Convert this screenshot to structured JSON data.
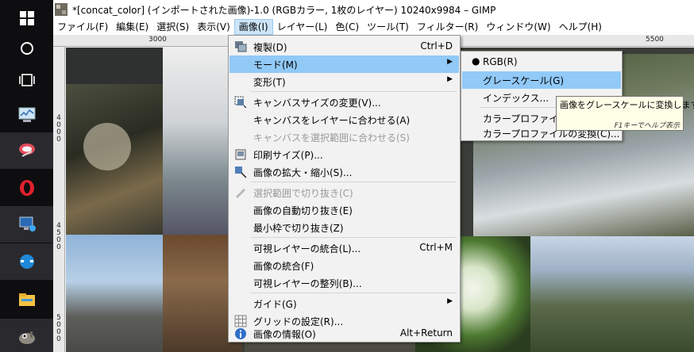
{
  "window": {
    "title": "*[concat_color] (インポートされた画像)-1.0 (RGBカラー, 1枚のレイヤー) 10240x9984 – GIMP"
  },
  "menubar": [
    {
      "label": "ファイル(F)"
    },
    {
      "label": "編集(E)"
    },
    {
      "label": "選択(S)"
    },
    {
      "label": "表示(V)"
    },
    {
      "label": "画像(I)"
    },
    {
      "label": "レイヤー(L)"
    },
    {
      "label": "色(C)"
    },
    {
      "label": "ツール(T)"
    },
    {
      "label": "フィルター(R)"
    },
    {
      "label": "ウィンドウ(W)"
    },
    {
      "label": "ヘルプ(H)"
    }
  ],
  "rulers": {
    "top": [
      "3000",
      "5500"
    ],
    "left": [
      "4000",
      "4500",
      "5000"
    ]
  },
  "image_menu": {
    "items": [
      {
        "label": "複製(D)",
        "shortcut": "Ctrl+D",
        "icon": "duplicate-icon"
      },
      {
        "label": "モード(M)",
        "submenu": true
      },
      {
        "label": "変形(T)",
        "submenu": true
      },
      {
        "label": "キャンバスサイズの変更(V)...",
        "icon": "canvas-size-icon"
      },
      {
        "label": "キャンバスをレイヤーに合わせる(A)"
      },
      {
        "label": "キャンバスを選択範囲に合わせる(S)",
        "disabled": true
      },
      {
        "label": "印刷サイズ(P)...",
        "icon": "print-size-icon"
      },
      {
        "label": "画像の拡大・縮小(S)...",
        "icon": "scale-icon"
      },
      {
        "label": "選択範囲で切り抜き(C)",
        "disabled": true,
        "icon": "crop-icon"
      },
      {
        "label": "画像の自動切り抜き(E)"
      },
      {
        "label": "最小枠で切り抜き(Z)"
      },
      {
        "label": "可視レイヤーの統合(L)...",
        "shortcut": "Ctrl+M"
      },
      {
        "label": "画像の統合(F)"
      },
      {
        "label": "可視レイヤーの整列(B)..."
      },
      {
        "label": "ガイド(G)",
        "submenu": true
      },
      {
        "label": "グリッドの設定(R)...",
        "icon": "grid-icon"
      },
      {
        "label": "画像の情報(O)",
        "shortcut": "Alt+Return",
        "icon": "info-icon"
      }
    ]
  },
  "mode_submenu": {
    "items": [
      {
        "label": "RGB(R)",
        "checked": true
      },
      {
        "label": "グレースケール(G)"
      },
      {
        "label": "インデックス..."
      },
      {
        "label": "カラープロファイルの割"
      },
      {
        "label": "カラープロファイルの変換(C)..."
      }
    ]
  },
  "tooltip": {
    "text": "画像をグレースケールに変換します",
    "hint": "F1キーでヘルプ表示"
  },
  "colors": {
    "menu_highlight": "#91c9f7",
    "menubar_active": "#cce4f7",
    "taskbar": "#0e0e10"
  }
}
